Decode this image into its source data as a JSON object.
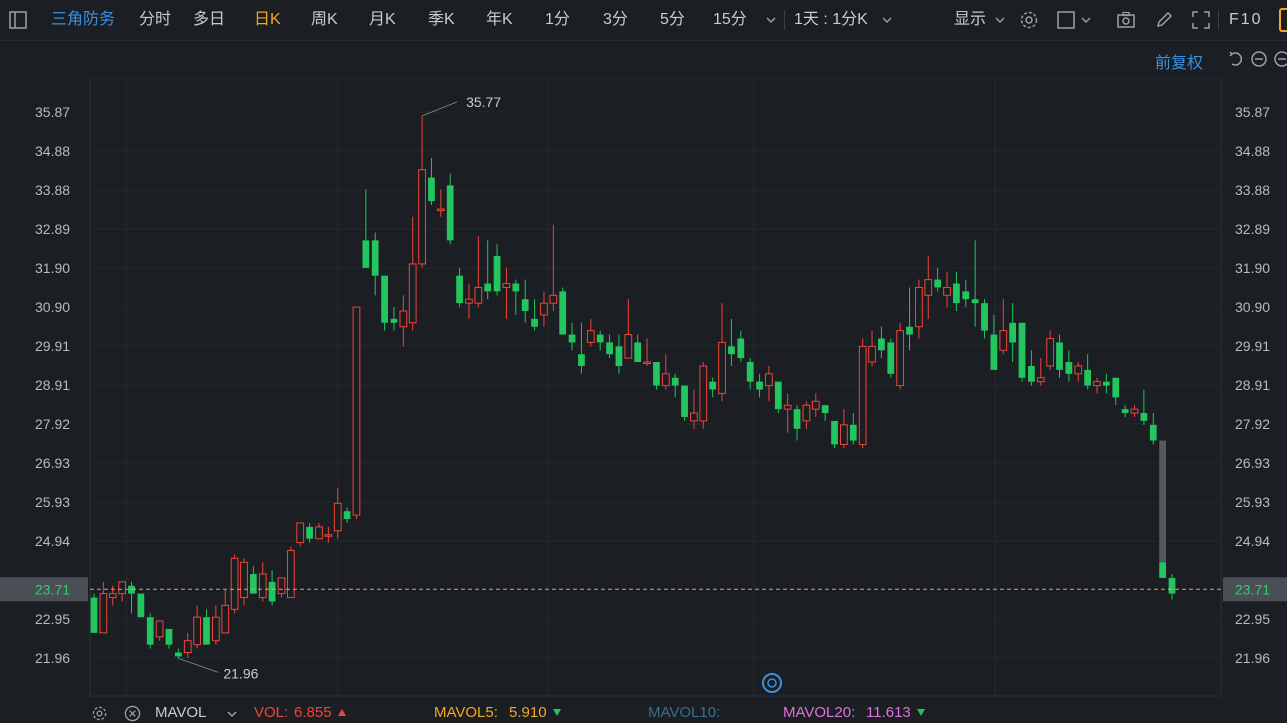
{
  "toolbar": {
    "stock_name": "三角防务",
    "tabs": [
      "分时",
      "多日",
      "日K",
      "周K",
      "月K",
      "季K",
      "年K",
      "1分",
      "3分",
      "5分",
      "15分"
    ],
    "active_tab": "日K",
    "interval_select": "1天 : 1分K",
    "display_label": "显示",
    "f10_label": "F10"
  },
  "subbar": {
    "adjust_label": "前复权"
  },
  "colors": {
    "up": "#f0453a",
    "down": "#22c55e",
    "accent": "#f5a623",
    "link": "#3d8fe0",
    "current": "#e8a070"
  },
  "chart_data": {
    "type": "candlestick",
    "y_ticks": [
      "35.87",
      "34.88",
      "33.88",
      "32.89",
      "31.90",
      "30.90",
      "29.91",
      "28.91",
      "27.92",
      "26.93",
      "25.93",
      "24.94",
      "22.95",
      "21.96"
    ],
    "ylim": [
      21.96,
      35.87
    ],
    "current_price": "23.71",
    "max_label": "35.77",
    "min_label": "21.96",
    "candles": [
      [
        23.5,
        22.6,
        23.6,
        22.6
      ],
      [
        22.6,
        23.6,
        23.9,
        22.6
      ],
      [
        23.5,
        23.6,
        23.8,
        23.3
      ],
      [
        23.6,
        23.9,
        23.9,
        23.4
      ],
      [
        23.8,
        23.6,
        23.9,
        23.1
      ],
      [
        23.6,
        23.0,
        23.6,
        23.0
      ],
      [
        23.0,
        22.3,
        23.1,
        22.2
      ],
      [
        22.5,
        22.9,
        22.9,
        22.4
      ],
      [
        22.7,
        22.3,
        22.7,
        22.2
      ],
      [
        22.1,
        22.0,
        22.2,
        21.95
      ],
      [
        22.1,
        22.4,
        22.6,
        21.96
      ],
      [
        22.3,
        23.0,
        23.3,
        22.2
      ],
      [
        23.0,
        22.3,
        23.2,
        22.3
      ],
      [
        22.4,
        23.0,
        23.3,
        22.3
      ],
      [
        22.6,
        23.3,
        23.7,
        22.6
      ],
      [
        23.2,
        24.5,
        24.6,
        23.1
      ],
      [
        23.5,
        24.4,
        24.5,
        23.3
      ],
      [
        24.1,
        23.6,
        24.3,
        23.6
      ],
      [
        23.5,
        24.1,
        24.4,
        23.4
      ],
      [
        23.9,
        23.4,
        24.2,
        23.3
      ],
      [
        23.6,
        24.0,
        24.0,
        23.5
      ],
      [
        23.5,
        24.7,
        24.8,
        23.5
      ],
      [
        24.9,
        25.4,
        25.4,
        24.8
      ],
      [
        25.3,
        25.0,
        25.4,
        24.9
      ],
      [
        25.0,
        25.3,
        25.4,
        25.0
      ],
      [
        25.1,
        25.1,
        25.3,
        24.9
      ],
      [
        25.2,
        25.9,
        26.3,
        25.0
      ],
      [
        25.7,
        25.5,
        25.8,
        25.4
      ],
      [
        25.6,
        30.9,
        30.9,
        25.5
      ],
      [
        32.6,
        31.9,
        33.9,
        31.9
      ],
      [
        32.6,
        31.7,
        32.8,
        31.2
      ],
      [
        31.7,
        30.5,
        31.7,
        30.3
      ],
      [
        30.6,
        30.5,
        30.9,
        30.3
      ],
      [
        30.4,
        30.8,
        31.2,
        29.9
      ],
      [
        30.5,
        32.0,
        33.2,
        30.3
      ],
      [
        32.0,
        34.4,
        35.77,
        31.9
      ],
      [
        34.2,
        33.6,
        34.7,
        33.5
      ],
      [
        33.4,
        33.4,
        33.9,
        33.2
      ],
      [
        34.0,
        32.6,
        34.3,
        32.5
      ],
      [
        31.7,
        31.0,
        31.9,
        30.9
      ],
      [
        31.0,
        31.1,
        31.5,
        30.6
      ],
      [
        31.0,
        31.4,
        32.7,
        30.9
      ],
      [
        31.5,
        31.3,
        32.6,
        31.1
      ],
      [
        32.2,
        31.3,
        32.5,
        31.2
      ],
      [
        31.4,
        31.5,
        31.9,
        30.6
      ],
      [
        31.5,
        31.3,
        31.6,
        30.7
      ],
      [
        31.1,
        30.8,
        31.6,
        30.5
      ],
      [
        30.6,
        30.4,
        31.1,
        30.3
      ],
      [
        30.7,
        31.0,
        31.3,
        30.4
      ],
      [
        31.0,
        31.2,
        33.0,
        30.8
      ],
      [
        31.3,
        30.2,
        31.4,
        30.2
      ],
      [
        30.2,
        30.0,
        30.5,
        29.8
      ],
      [
        29.7,
        29.4,
        30.5,
        29.2
      ],
      [
        30.0,
        30.3,
        30.6,
        29.9
      ],
      [
        30.2,
        30.0,
        30.3,
        29.8
      ],
      [
        30.0,
        29.7,
        30.2,
        29.6
      ],
      [
        29.9,
        29.4,
        30.2,
        29.2
      ],
      [
        29.6,
        30.2,
        31.1,
        29.6
      ],
      [
        30.0,
        29.5,
        30.2,
        29.5
      ],
      [
        29.5,
        29.5,
        30.1,
        29.4
      ],
      [
        29.5,
        28.9,
        29.5,
        28.8
      ],
      [
        28.9,
        29.2,
        29.7,
        28.8
      ],
      [
        29.1,
        28.9,
        29.2,
        28.6
      ],
      [
        28.9,
        28.1,
        28.9,
        28.0
      ],
      [
        28.0,
        28.2,
        28.8,
        27.8
      ],
      [
        28.0,
        29.4,
        29.5,
        27.8
      ],
      [
        29.0,
        28.8,
        29.1,
        28.6
      ],
      [
        28.7,
        30.0,
        31.0,
        28.5
      ],
      [
        29.9,
        29.7,
        30.6,
        29.4
      ],
      [
        30.1,
        29.6,
        30.3,
        29.5
      ],
      [
        29.5,
        29.0,
        29.6,
        28.8
      ],
      [
        29.0,
        28.8,
        29.2,
        28.6
      ],
      [
        28.9,
        29.2,
        29.4,
        28.5
      ],
      [
        29.0,
        28.3,
        29.0,
        28.2
      ],
      [
        28.3,
        28.4,
        28.7,
        27.7
      ],
      [
        28.3,
        27.8,
        28.4,
        27.5
      ],
      [
        28.0,
        28.4,
        28.5,
        27.8
      ],
      [
        28.3,
        28.5,
        28.7,
        28.1
      ],
      [
        28.4,
        28.2,
        28.4,
        28.0
      ],
      [
        28.0,
        27.4,
        28.0,
        27.3
      ],
      [
        27.4,
        27.9,
        28.3,
        27.3
      ],
      [
        27.9,
        27.5,
        28.2,
        27.4
      ],
      [
        27.4,
        29.9,
        30.1,
        27.3
      ],
      [
        29.5,
        29.9,
        30.3,
        29.4
      ],
      [
        30.1,
        29.8,
        30.4,
        29.6
      ],
      [
        30.0,
        29.2,
        30.1,
        29.1
      ],
      [
        28.9,
        30.3,
        30.5,
        28.8
      ],
      [
        30.4,
        30.2,
        31.4,
        29.8
      ],
      [
        30.4,
        31.4,
        31.6,
        30.1
      ],
      [
        31.2,
        31.6,
        32.2,
        30.6
      ],
      [
        31.6,
        31.4,
        31.9,
        31.3
      ],
      [
        31.2,
        31.4,
        31.8,
        30.9
      ],
      [
        31.5,
        31.0,
        31.8,
        30.8
      ],
      [
        31.3,
        31.1,
        31.6,
        30.9
      ],
      [
        31.1,
        31.0,
        32.6,
        30.4
      ],
      [
        31.0,
        30.3,
        31.1,
        30.1
      ],
      [
        30.2,
        29.3,
        30.7,
        29.3
      ],
      [
        29.8,
        30.3,
        31.1,
        29.7
      ],
      [
        30.5,
        30.0,
        31.0,
        29.5
      ],
      [
        30.5,
        29.1,
        30.5,
        29.0
      ],
      [
        29.4,
        29.0,
        29.8,
        28.9
      ],
      [
        29.0,
        29.1,
        29.6,
        28.9
      ],
      [
        29.4,
        30.1,
        30.3,
        29.3
      ],
      [
        30.0,
        29.3,
        30.2,
        29.1
      ],
      [
        29.5,
        29.2,
        29.8,
        29.0
      ],
      [
        29.2,
        29.4,
        29.5,
        29.0
      ],
      [
        29.3,
        28.9,
        29.7,
        28.8
      ],
      [
        28.9,
        29.0,
        29.1,
        28.7
      ],
      [
        29.0,
        28.9,
        29.2,
        28.7
      ],
      [
        29.1,
        28.6,
        29.1,
        28.4
      ],
      [
        28.3,
        28.2,
        28.4,
        28.1
      ],
      [
        28.2,
        28.3,
        28.4,
        28.1
      ],
      [
        28.2,
        28.0,
        28.8,
        27.9
      ],
      [
        27.9,
        27.5,
        28.2,
        27.4
      ],
      [
        24.4,
        24.0,
        24.4,
        24.0
      ],
      [
        24.0,
        23.6,
        24.1,
        23.45
      ]
    ]
  },
  "bottom": {
    "indicator": "MAVOL",
    "vol_label": "VOL:",
    "vol_value": "6.855",
    "mavol5_label": "MAVOL5:",
    "mavol5_value": "5.910",
    "mavol10_label": "MAVOL10:",
    "mavol20_label": "MAVOL20:",
    "mavol20_value": "11.613"
  }
}
